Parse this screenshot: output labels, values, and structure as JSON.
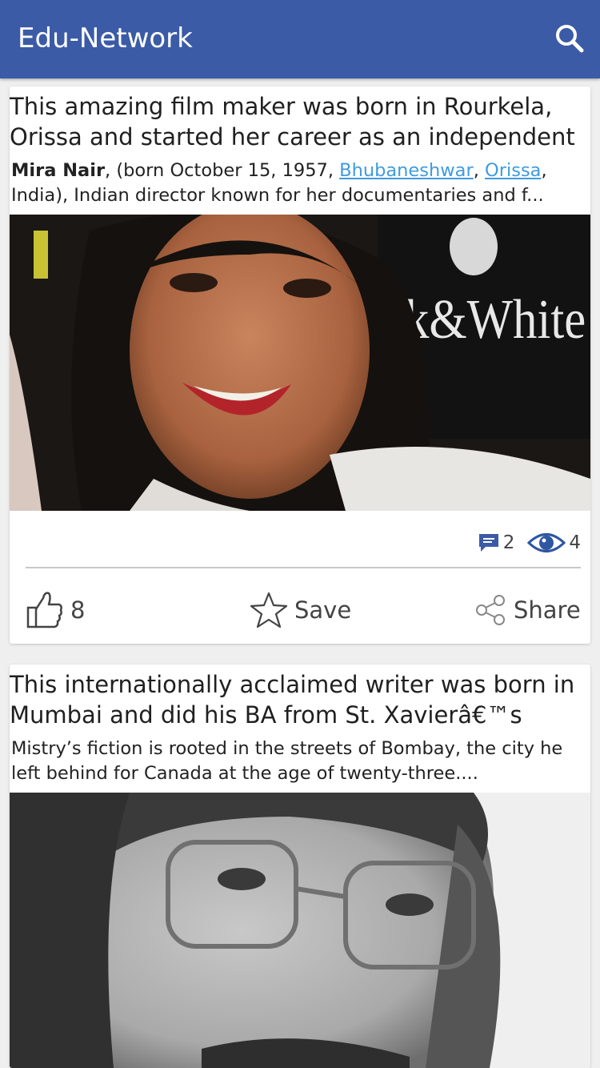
{
  "app": {
    "title": "Edu-Network"
  },
  "colors": {
    "appbar": "#3b5ba6",
    "link": "#3e9be0",
    "comment_icon": "#3b5ba6",
    "eye_icon": "#2f56a0"
  },
  "posts": [
    {
      "title": "This amazing film maker was born in Rourkela, Orissa and started her career as an independent",
      "excerpt": {
        "name": "Mira Nair",
        "text1": ", (born October 15, 1957, ",
        "link1": "Bhubaneshwar",
        "sep": ", ",
        "link2": "Orissa",
        "text2": ", India), Indian director known for her documentaries and f..."
      },
      "comments": "2",
      "views": "4",
      "likes": "8",
      "save_label": "Save",
      "share_label": "Share",
      "photo_icon": "portrait-photo"
    },
    {
      "title": "This internationally acclaimed writer was born in Mumbai and did his BA from St. Xavierâ€™s",
      "excerpt_text": "Mistry’s fiction is rooted in the streets of Bombay, the city he left behind for Canada at the age of twenty-three....",
      "photo_icon": "portrait-photo"
    }
  ]
}
